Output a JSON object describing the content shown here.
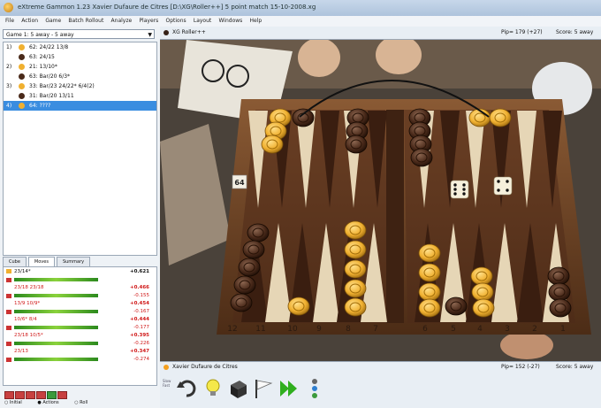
{
  "window": {
    "title": "eXtreme Gammon 1.23 Xavier Dufaure de Citres  [D:\\XG\\Roller++] 5 point match 15-10-2008.xg"
  },
  "menu": [
    "File",
    "Action",
    "Game",
    "Batch Rollout",
    "Analyze",
    "Players",
    "Options",
    "Layout",
    "Windows",
    "Help"
  ],
  "match_selector": {
    "value": "Game 1: 5 away - 5 away"
  },
  "moves": [
    {
      "num": "1)",
      "player": "orange",
      "text": "62: 24/22 13/8"
    },
    {
      "num": "",
      "player": "brown",
      "text": "63: 24/15"
    },
    {
      "num": "2)",
      "player": "orange",
      "text": "21: 13/10*"
    },
    {
      "num": "",
      "player": "brown",
      "text": "63: Bar/20 6/3*"
    },
    {
      "num": "3)",
      "player": "orange",
      "text": "33: Bar/23 24/22* 6/4(2)"
    },
    {
      "num": "",
      "player": "brown",
      "text": "31: Bar/20 13/11"
    },
    {
      "num": "4)",
      "player": "orange",
      "text": "64: ????"
    }
  ],
  "tabs": [
    "Cube",
    "Moves",
    "Summary"
  ],
  "analysis": [
    {
      "move": "23/14*",
      "equity": "+0.621",
      "red": false,
      "diff": ""
    },
    {
      "move": "23/18 23/18",
      "equity": "+0.466",
      "red": true,
      "diff": "-0.155"
    },
    {
      "move": "13/9 10/9*",
      "equity": "+0.454",
      "red": true,
      "diff": "-0.167"
    },
    {
      "move": "10/6* 8/4",
      "equity": "+0.444",
      "red": true,
      "diff": "-0.177"
    },
    {
      "move": "23/18 10/5*",
      "equity": "+0.395",
      "red": true,
      "diff": "-0.226"
    },
    {
      "move": "23/13",
      "equity": "+0.347",
      "red": true,
      "diff": "-0.274"
    }
  ],
  "radio_options": [
    "Initial",
    "Actions",
    "Roll"
  ],
  "top_player": {
    "name": "XG Roller++",
    "pips": "Pip= 179 (+27)",
    "score": "Score: 5 away"
  },
  "bottom_player": {
    "name": "Xavier Dufaure de Citres",
    "pips": "Pip= 152 (-27)",
    "score": "Score: 5 away"
  },
  "point_numbers": [
    "12",
    "11",
    "10",
    "9",
    "8",
    "7",
    "6",
    "5",
    "4",
    "3",
    "2",
    "1"
  ],
  "dice": [
    6,
    4
  ],
  "cube_value": "64",
  "colors": {
    "orange_checker": "#f0b030",
    "brown_checker": "#4a2a1a",
    "board_wood": "#5a3520",
    "selection": "#3a8de0"
  },
  "icons": [
    "undo-icon",
    "hint-icon",
    "cube-icon",
    "resign-flag-icon",
    "double-play-icon",
    "analyze-icon"
  ]
}
